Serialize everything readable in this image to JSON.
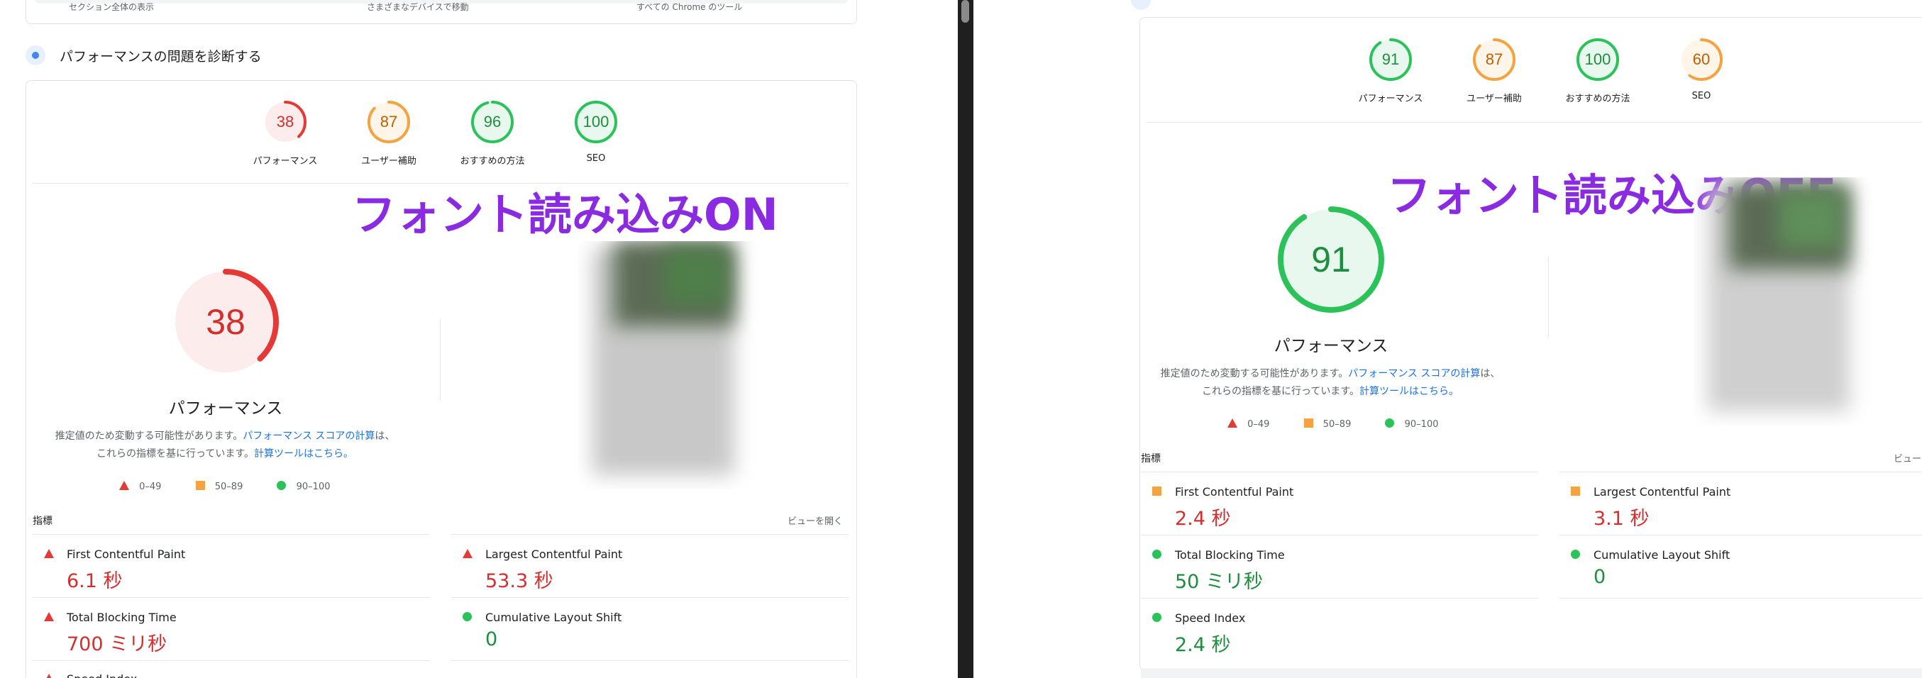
{
  "left": {
    "top_bar_items": [
      "セクション全体の表示",
      "さまざまなデバイスで移動",
      "すべての Chrome のツール"
    ],
    "section_title": "パフォーマンスの問題を診断する",
    "overlay_text": "フォント読み込みON",
    "scores": [
      {
        "value": "38",
        "label": "パフォーマンス",
        "score": 38,
        "color": "#e53935",
        "fill": "#fdecec"
      },
      {
        "value": "87",
        "label": "ユーザー補助",
        "score": 87,
        "color": "#f4a340",
        "fill": "#fff5e8"
      },
      {
        "value": "96",
        "label": "おすすめの方法",
        "score": 96,
        "color": "#2bc25a",
        "fill": "#e9f8ee"
      },
      {
        "value": "100",
        "label": "SEO",
        "score": 100,
        "color": "#2bc25a",
        "fill": "#e9f8ee"
      }
    ],
    "big_gauge": {
      "value": "38",
      "label": "パフォーマンス",
      "score": 38,
      "color": "#e53935",
      "fill": "#fdecec"
    },
    "description": {
      "text1": "推定値のため変動する可能性があります。",
      "link1": "パフォーマンス スコアの計算",
      "text2": "は、これらの指標を基に行っています。",
      "link2": "計算ツールはこちら。"
    },
    "legend": [
      "0–49",
      "50–89",
      "90–100"
    ],
    "metrics_label": "指標",
    "view_toggle": "ビューを開く",
    "metrics": [
      {
        "name": "First Contentful Paint",
        "value": "6.1 秒",
        "status": "red"
      },
      {
        "name": "Largest Contentful Paint",
        "value": "53.3 秒",
        "status": "red"
      },
      {
        "name": "Total Blocking Time",
        "value": "700 ミリ秒",
        "status": "red"
      },
      {
        "name": "Cumulative Layout Shift",
        "value": "0",
        "status": "green"
      },
      {
        "name": "Speed Index",
        "value": "",
        "status": "red"
      }
    ]
  },
  "right": {
    "overlay_text": "フォント読み込みOFF",
    "scores": [
      {
        "value": "91",
        "label": "パフォーマンス",
        "score": 91,
        "color": "#2bc25a",
        "fill": "#e9f8ee"
      },
      {
        "value": "87",
        "label": "ユーザー補助",
        "score": 87,
        "color": "#f4a340",
        "fill": "#fff5e8"
      },
      {
        "value": "100",
        "label": "おすすめの方法",
        "score": 100,
        "color": "#2bc25a",
        "fill": "#e9f8ee"
      },
      {
        "value": "60",
        "label": "SEO",
        "score": 60,
        "color": "#f4a340",
        "fill": "#fff5e8"
      }
    ],
    "big_gauge": {
      "value": "91",
      "label": "パフォーマンス",
      "score": 91,
      "color": "#2bc25a",
      "fill": "#e9f8ee"
    },
    "description": {
      "text1": "推定値のため変動する可能性があります。",
      "link1": "パフォーマンス スコアの計算",
      "text2": "は、これらの指標を基に行っています。",
      "link2": "計算ツールはこちら。"
    },
    "legend": [
      "0–49",
      "50–89",
      "90–100"
    ],
    "metrics_label": "指標",
    "view_toggle": "ビュー",
    "metrics": [
      {
        "name": "First Contentful Paint",
        "value": "2.4 秒",
        "status": "orange"
      },
      {
        "name": "Largest Contentful Paint",
        "value": "3.1 秒",
        "status": "orange"
      },
      {
        "name": "Total Blocking Time",
        "value": "50 ミリ秒",
        "status": "green"
      },
      {
        "name": "Cumulative Layout Shift",
        "value": "0",
        "status": "green"
      },
      {
        "name": "Speed Index",
        "value": "2.4 秒",
        "status": "green"
      }
    ]
  }
}
